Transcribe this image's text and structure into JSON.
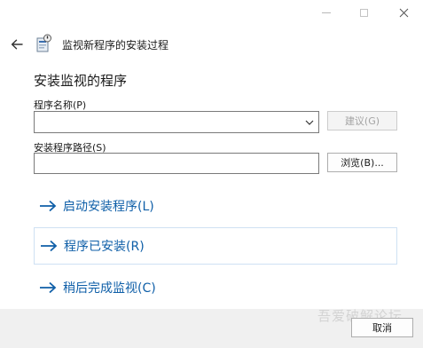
{
  "titlebar": {
    "minimize_icon": "minimize-icon",
    "maximize_icon": "maximize-icon",
    "close_icon": "close-icon"
  },
  "header": {
    "back_icon": "back-arrow-icon",
    "app_icon": "program-install-icon",
    "title": "监视新程序的安装过程"
  },
  "main": {
    "section_title": "安装监视的程序",
    "program_name_label": "程序名称(P)",
    "program_name_value": "",
    "suggest_button": "建议(G)",
    "install_path_label": "安装程序路径(S)",
    "install_path_value": "",
    "browse_button": "浏览(B)...",
    "commands": [
      {
        "label": "启动安装程序(L)",
        "icon": "arrow-right-icon"
      },
      {
        "label": "程序已安装(R)",
        "icon": "arrow-right-icon"
      },
      {
        "label": "稍后完成监视(C)",
        "icon": "arrow-right-icon"
      }
    ]
  },
  "footer": {
    "cancel_button": "取消",
    "watermark": "吾爱破解论坛"
  },
  "colors": {
    "accent": "#0f5fa8",
    "footer_bg": "#f0f0f0",
    "disabled_text": "#a3a3a3"
  }
}
